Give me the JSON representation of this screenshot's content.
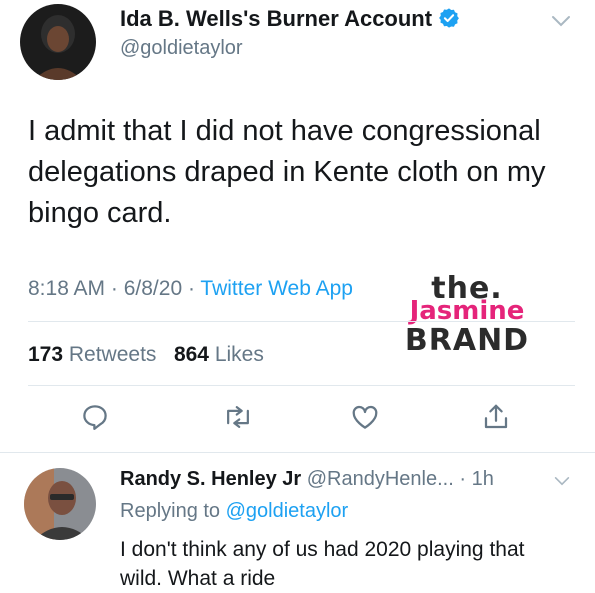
{
  "tweet": {
    "display_name": "Ida B. Wells's Burner Account",
    "handle": "@goldietaylor",
    "text": "I admit that I did not have congressional delegations draped in Kente cloth on my bingo card.",
    "time": "8:18 AM",
    "sep1": " · ",
    "date": "6/8/20",
    "sep2": " · ",
    "source": "Twitter Web App",
    "retweets_count": "173",
    "retweets_label": " Retweets",
    "likes_count": "864",
    "likes_label": " Likes"
  },
  "watermark": {
    "line1": "the.",
    "line2": "Jasmine",
    "line3": "BRAND"
  },
  "reply": {
    "display_name": "Randy S. Henley Jr",
    "handle": " @RandyHenle...",
    "time": " · 1h",
    "replying_prefix": "Replying to ",
    "replying_handle": "@goldietaylor",
    "text": "I don't think any of us had 2020 playing that wild. What a ride"
  },
  "colors": {
    "link": "#1da1f2",
    "secondary": "#657786",
    "brand_pink": "#e5247a"
  },
  "icons": {
    "verified": "verified-badge-icon",
    "chevron": "chevron-down-icon",
    "reply": "reply-icon",
    "retweet": "retweet-icon",
    "like": "heart-icon",
    "share": "share-icon"
  }
}
